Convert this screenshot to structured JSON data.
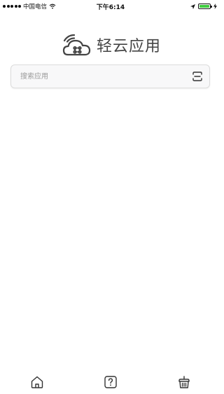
{
  "status_bar": {
    "carrier": "中国电信",
    "time": "下午6:14"
  },
  "logo": {
    "text": "轻云应用",
    "icon": "cloud-wifi-logo-icon"
  },
  "search": {
    "placeholder": "搜索应用",
    "value": "",
    "scan_icon": "scan-icon"
  },
  "bottom_nav": {
    "items": [
      {
        "icon": "home-icon"
      },
      {
        "icon": "help-icon"
      },
      {
        "icon": "basket-icon"
      }
    ]
  },
  "colors": {
    "battery": "#3fcc3f",
    "logo": "#444444",
    "search_bg": "#f8f8f9",
    "icon_stroke": "#333333"
  }
}
